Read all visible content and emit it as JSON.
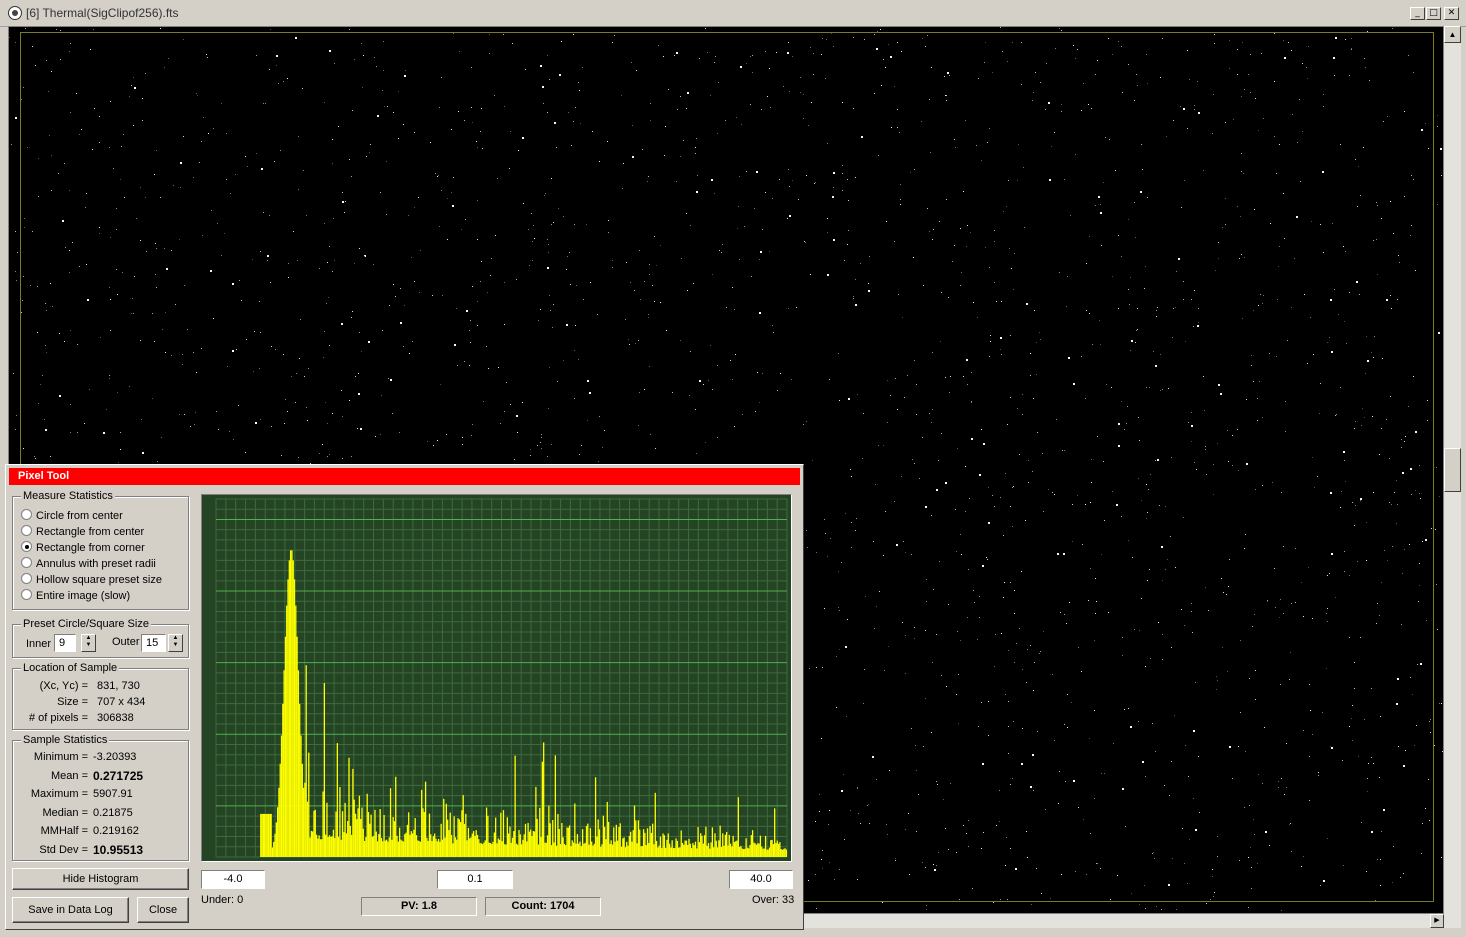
{
  "window": {
    "title": "[6] Thermal(SigClipof256).fts"
  },
  "pixel_tool": {
    "title": "Pixel Tool",
    "measure": {
      "legend": "Measure Statistics",
      "options": [
        "Circle from center",
        "Rectangle from center",
        "Rectangle from corner",
        "Annulus with preset radii",
        "Hollow square preset size",
        "Entire image (slow)"
      ],
      "selected": "Rectangle from corner"
    },
    "preset": {
      "legend": "Preset Circle/Square Size",
      "inner_label": "Inner",
      "inner_value": "9",
      "outer_label": "Outer",
      "outer_value": "15"
    },
    "location": {
      "legend": "Location of Sample",
      "xcyc_label": "(Xc, Yc) =",
      "xcyc_value": "831,  730",
      "size_label": "Size =",
      "size_value": "707 x  434",
      "pixels_label": "# of pixels =",
      "pixels_value": "306838"
    },
    "stats": {
      "legend": "Sample Statistics",
      "rows": [
        {
          "label": "Minimum =",
          "value": "-3.20393",
          "bold": false
        },
        {
          "label": "Mean =",
          "value": "0.271725",
          "bold": true
        },
        {
          "label": "Maximum =",
          "value": "5907.91",
          "bold": false
        },
        {
          "label": "Median =",
          "value": "0.21875",
          "bold": false
        },
        {
          "label": "MMHalf =",
          "value": "0.219162",
          "bold": false
        },
        {
          "label": "Std Dev =",
          "value": "10.95513",
          "bold": true
        }
      ]
    },
    "buttons": {
      "hide_histogram": "Hide Histogram",
      "save_log": "Save in Data Log",
      "close": "Close"
    },
    "histogram": {
      "min_field": "-4.0",
      "step_field": "0.1",
      "max_field": "40.0",
      "under": "Under: 0",
      "over": "Over: 33",
      "pv": "PV: 1.8",
      "count": "Count: 1704"
    }
  },
  "chart_data": {
    "type": "bar",
    "x_range": [
      -4.0,
      40.0
    ],
    "bin_width": 0.1,
    "peak_x": 1.8,
    "peak_count": 1704,
    "grid": true,
    "bar_color": "#ffff00",
    "background_color": "#244424"
  },
  "colors": {
    "panel_title": "#ff0000",
    "image_bg": "#000000",
    "image_border": "#7d7a27"
  }
}
